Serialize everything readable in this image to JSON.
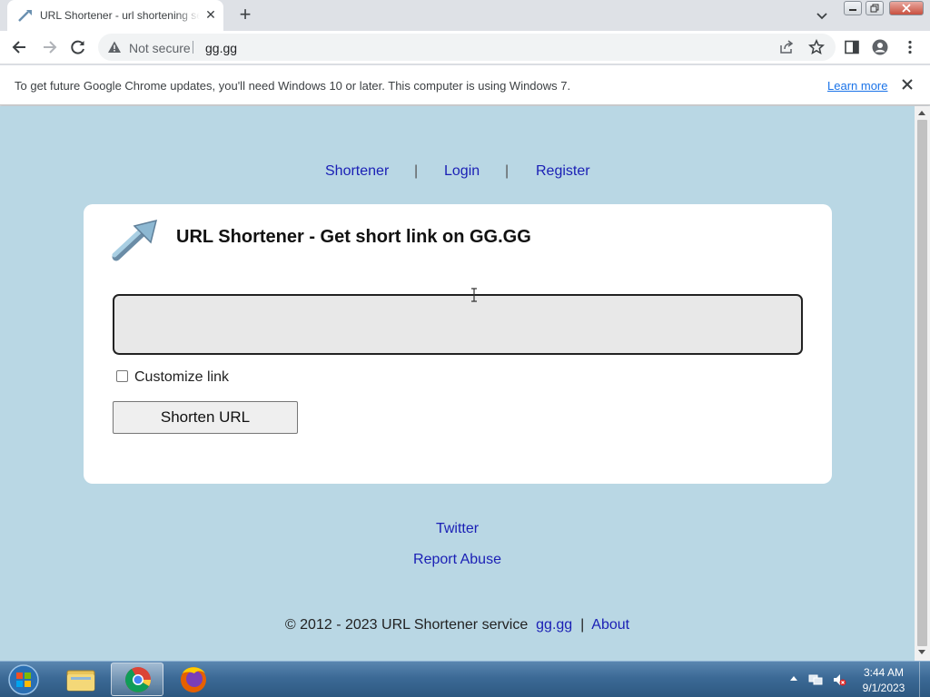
{
  "browser": {
    "tab_title": "URL Shortener - url shortening se",
    "tab_close": "✕",
    "new_tab": "+",
    "omnibox": {
      "security_label": "Not secure",
      "url": "gg.gg"
    },
    "infobar": {
      "message": "To get future Google Chrome updates, you'll need Windows 10 or later. This computer is using Windows 7.",
      "link": "Learn more"
    }
  },
  "page": {
    "nav": {
      "items": [
        "Shortener",
        "Login",
        "Register"
      ],
      "separator": "|"
    },
    "card": {
      "title": "URL Shortener - Get short link on GG.GG",
      "url_input_value": "",
      "customize_label": "Customize link",
      "customize_checked": false,
      "submit_label": "Shorten URL"
    },
    "footer": {
      "twitter": "Twitter",
      "report_abuse": "Report Abuse",
      "copyright": "© 2012 - 2023 URL Shortener service",
      "site_link": "gg.gg",
      "separator": "|",
      "about": "About"
    },
    "colors": {
      "background": "#b9d7e4",
      "link": "#1a1fb5"
    }
  },
  "taskbar": {
    "apps": [
      "windows-explorer-icon",
      "chrome-icon",
      "firefox-icon"
    ],
    "active_app": "chrome-icon",
    "clock_time": "3:44 AM",
    "clock_date": "9/1/2023"
  }
}
